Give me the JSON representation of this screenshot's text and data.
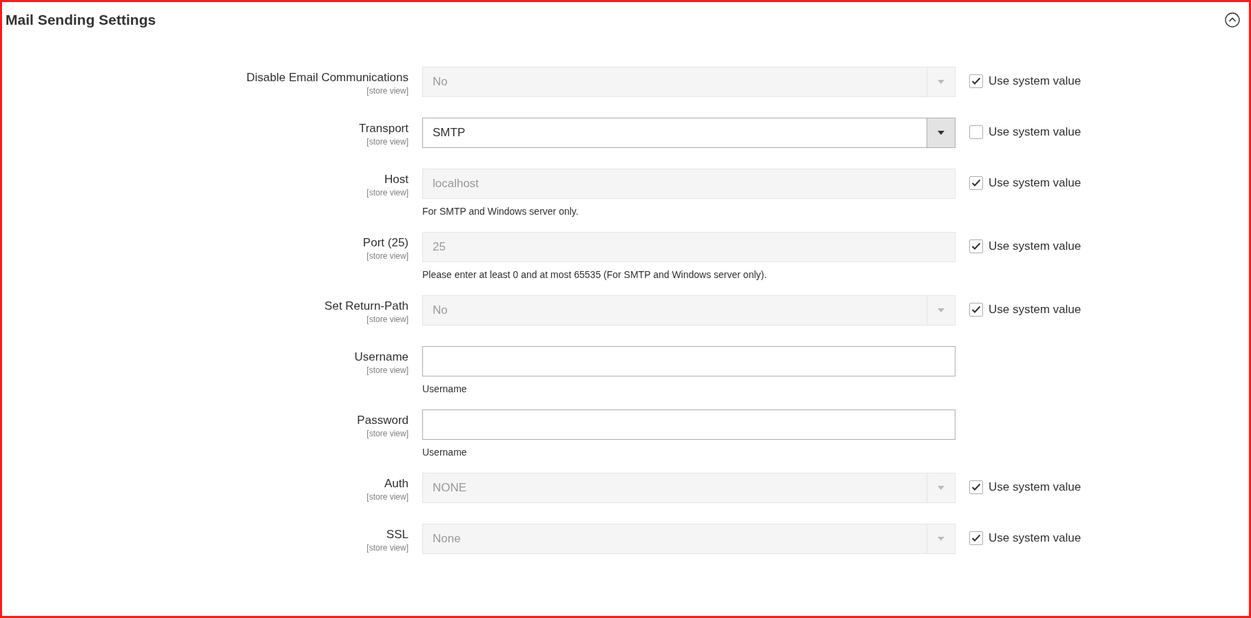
{
  "section": {
    "title": "Mail Sending Settings",
    "expanded": true
  },
  "rows": [
    {
      "label": "Disable Email Communications",
      "scope": "[store view]",
      "kind": "select",
      "value": "No",
      "disabled": true,
      "use_system": {
        "label": "Use system value",
        "checked": true
      }
    },
    {
      "label": "Transport",
      "scope": "[store view]",
      "kind": "select",
      "value": "SMTP",
      "disabled": false,
      "use_system": {
        "label": "Use system value",
        "checked": false
      }
    },
    {
      "label": "Host",
      "scope": "[store view]",
      "kind": "text",
      "value": "localhost",
      "disabled": true,
      "note": "For SMTP and Windows server only.",
      "use_system": {
        "label": "Use system value",
        "checked": true
      }
    },
    {
      "label": "Port (25)",
      "scope": "[store view]",
      "kind": "text",
      "value": "25",
      "disabled": true,
      "note": "Please enter at least 0 and at most 65535 (For SMTP and Windows server only).",
      "use_system": {
        "label": "Use system value",
        "checked": true
      }
    },
    {
      "label": "Set Return-Path",
      "scope": "[store view]",
      "kind": "select",
      "value": "No",
      "disabled": true,
      "use_system": {
        "label": "Use system value",
        "checked": true
      }
    },
    {
      "label": "Username",
      "scope": "[store view]",
      "kind": "text",
      "disabled": false,
      "note": "Username"
    },
    {
      "label": "Password",
      "scope": "[store view]",
      "kind": "text",
      "disabled": false,
      "note": "Username"
    },
    {
      "label": "Auth",
      "scope": "[store view]",
      "kind": "select",
      "value": "NONE",
      "disabled": true,
      "use_system": {
        "label": "Use system value",
        "checked": true
      }
    },
    {
      "label": "SSL",
      "scope": "[store view]",
      "kind": "select",
      "value": "None",
      "disabled": true,
      "use_system": {
        "label": "Use system value",
        "checked": true
      }
    }
  ]
}
